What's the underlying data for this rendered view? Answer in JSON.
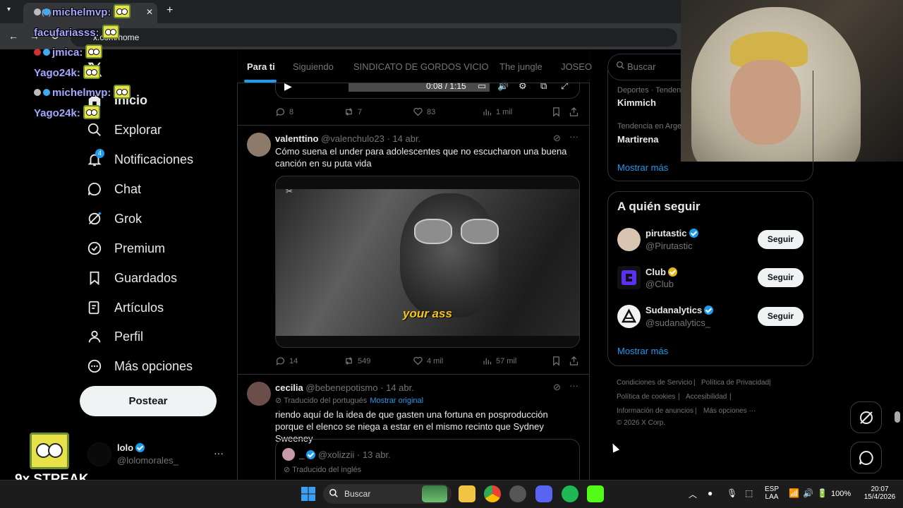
{
  "browser": {
    "tab_title": "(4) Inicio / X",
    "url": "x.com/home"
  },
  "chat": [
    {
      "user": "michelmvp:"
    },
    {
      "user": "facufariasss:"
    },
    {
      "user": "jmica:"
    },
    {
      "user": "Yago24k:"
    },
    {
      "user": "michelmvp:"
    },
    {
      "user": "Yago24k:"
    }
  ],
  "streak": "9x STREAK",
  "nav": {
    "items": [
      {
        "label": "Inicio"
      },
      {
        "label": "Explorar"
      },
      {
        "label": "Notificaciones"
      },
      {
        "label": "Chat"
      },
      {
        "label": "Grok"
      },
      {
        "label": "Premium"
      },
      {
        "label": "Guardados"
      },
      {
        "label": "Artículos"
      },
      {
        "label": "Perfil"
      },
      {
        "label": "Más opciones"
      }
    ],
    "notif_badge": "4",
    "post_label": "Postear",
    "account": {
      "name": "lolo",
      "handle": "@lolomorales_"
    }
  },
  "feed_tabs": [
    "Para ti",
    "Siguiendo",
    "SINDICATO DE GORDOS VICIO",
    "The jungle",
    "JOSEO"
  ],
  "video": {
    "time": "0:08 / 1:15"
  },
  "post0": {
    "replies": "8",
    "reposts": "7",
    "likes": "83",
    "views": "1 mil"
  },
  "post1": {
    "name": "valenttino",
    "handle": "@valenchulo23",
    "date": "· 14 abr.",
    "text": "Cómo suena el under para adolescentes que no escucharon una buena canción en su puta vida",
    "caption": "your ass",
    "replies": "14",
    "reposts": "549",
    "likes": "4 mil",
    "views": "57 mil"
  },
  "post2": {
    "name": "cecilia",
    "handle": "@bebenepotismo",
    "date": "· 14 abr.",
    "translated": "Traducido del portugués",
    "show_original": "Mostrar original",
    "text": "riendo aquí de la idea de que gasten una fortuna en posproducción porque el elenco se niega a estar en el mismo recinto que Sydney Sweeney",
    "quote": {
      "name": "_",
      "handle": "@xolizzii",
      "date": "· 13 abr.",
      "translated": "Traducido del inglés"
    }
  },
  "right": {
    "search_placeholder": "Buscar",
    "trends": [
      {
        "meta": "Deportes · Tenden",
        "name": "Kimmich"
      },
      {
        "meta": "Tendencia en Arge",
        "name": "Martirena"
      }
    ],
    "show_more": "Mostrar más",
    "who_to_follow": "A quién seguir",
    "follow": [
      {
        "name": "pirutastic",
        "handle": "@Pirutastic",
        "button": "Seguir"
      },
      {
        "name": "Club",
        "handle": "@Club",
        "button": "Seguir"
      },
      {
        "name": "Sudanalytics",
        "handle": "@sudanalytics_",
        "button": "Seguir"
      }
    ],
    "show_more_2": "Mostrar más",
    "footer": [
      "Condiciones de Servicio",
      "Política de Privacidad",
      "Política de cookies",
      "Accesibilidad",
      "Información de anuncios",
      "Más opciones ···",
      "© 2026 X Corp."
    ]
  },
  "taskbar": {
    "search": "Buscar",
    "lang1": "ESP",
    "lang2": "LAA",
    "battery": "100%",
    "time": "20:07",
    "date": "15/4/2026"
  },
  "colors": {
    "accent": "#1d9bf0",
    "gold": "#e2b719"
  }
}
